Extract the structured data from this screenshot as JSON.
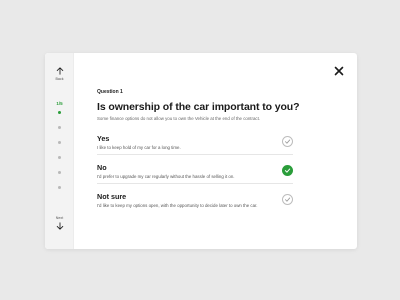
{
  "colors": {
    "accent": "#2a9d3a",
    "background": "#e9e9e9",
    "card": "#ffffff",
    "rail": "#f3f3f3"
  },
  "nav": {
    "back_label": "Back",
    "back_icon": "arrow-up-icon",
    "next_label": "Next",
    "next_icon": "arrow-down-icon"
  },
  "progress": {
    "label": "1/5",
    "current": 1,
    "total": 5
  },
  "close_icon": "close-icon",
  "question": {
    "number": "Question 1",
    "title": "Is ownership of the car important to you?",
    "subtitle": "Some finance options do not allow you to own the Vehicle at the end of the contract."
  },
  "options": [
    {
      "title": "Yes",
      "description": "I like to keep hold of my car for a long time.",
      "selected": false
    },
    {
      "title": "No",
      "description": "I'd prefer to upgrade my car regularly without the hassle of selling it on.",
      "selected": true
    },
    {
      "title": "Not sure",
      "description": "I'd like to keep my options open, with the opportunity to decide later to own the car.",
      "selected": false
    }
  ]
}
